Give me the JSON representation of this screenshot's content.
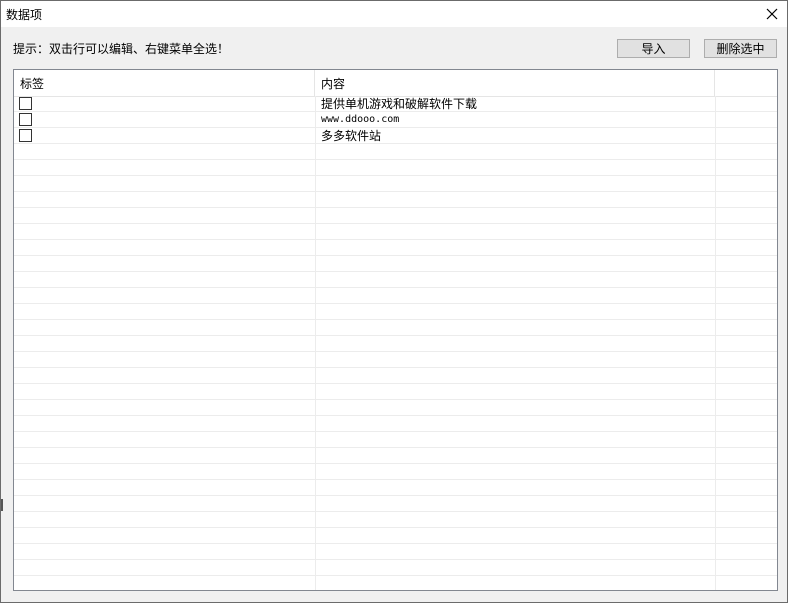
{
  "window": {
    "title": "数据项"
  },
  "hint": "提示：双击行可以编辑、右键菜单全选！",
  "buttons": {
    "import": "导入",
    "delete_selected": "删除选中"
  },
  "table": {
    "columns": [
      "标签",
      "内容"
    ],
    "rows": [
      {
        "label": "",
        "checked": false,
        "content": "提供单机游戏和破解软件下载"
      },
      {
        "label": "",
        "checked": false,
        "content": "www.ddooo.com"
      },
      {
        "label": "",
        "checked": false,
        "content": "多多软件站"
      }
    ]
  }
}
